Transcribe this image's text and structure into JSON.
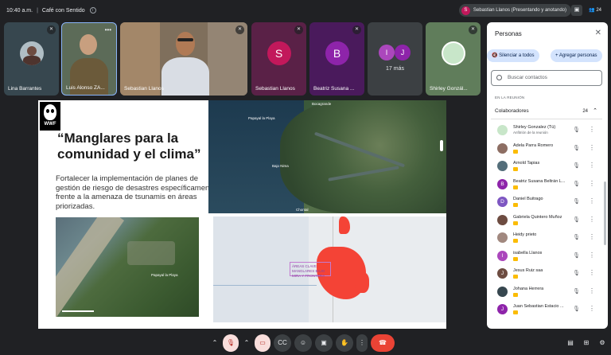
{
  "topbar": {
    "time": "10:40 a.m.",
    "meeting_name": "Café con Sentido",
    "presenter_initial": "S",
    "presenter_label": "Sebastian Llanos (Presentando y anotando)",
    "participant_count": "24"
  },
  "tiles": [
    {
      "name": "Lina Barrantes"
    },
    {
      "name": "Luis Alonso ZA..."
    },
    {
      "name": "Sebastian Llanos"
    },
    {
      "initial": "S",
      "name": "Sebastian Llanos",
      "color": "#c2185b"
    },
    {
      "initial": "B",
      "name": "Beatriz Susana ...",
      "color": "#8e24aa"
    },
    {
      "initials": [
        "I",
        "J"
      ],
      "more": "17 más"
    },
    {
      "name": "Shirley Gonzál..."
    }
  ],
  "slide": {
    "logo_text": "WWF",
    "title": "“Manglares para la comunidad y el clima”",
    "body": "Fortalecer la implementación de planes de gestión de riesgo de desastres específicamente frente a la amenaza de tsunamis en áreas priorizadas.",
    "map_labels": {
      "bocagrande": "Bocagrande",
      "papayal": "Papayal la Playa",
      "chontal": "Chontal",
      "bajonama": "Bajo Nima",
      "papayal_la_playa": "Papayal la Playa",
      "areas_box": "ÁREAS CLAVE MANGLARES BAJO MIRA Y FRONTERA"
    }
  },
  "panel": {
    "title": "Personas",
    "mute_all": "Silenciar a todos",
    "add_people": "Agregar personas",
    "search_placeholder": "Buscar contactos",
    "section": "EN LA REUNIÓN",
    "collaborators": "Colaboradores",
    "collaborators_count": "24",
    "people": [
      {
        "name": "Shirley Gonzalez (Tú)",
        "sub": "Anfitrión de la reunión",
        "color": "#c8e6c9"
      },
      {
        "name": "Adela Parra Romero",
        "color": "#8d6e63"
      },
      {
        "name": "Arnold Tapias",
        "color": "#546e7a"
      },
      {
        "name": "Beatriz Susana Beltrán L...",
        "initial": "B",
        "color": "#8e24aa"
      },
      {
        "name": "Daniel Buitrago",
        "initial": "D",
        "color": "#7e57c2"
      },
      {
        "name": "Gabriela Quintero Muñoz",
        "color": "#6d4c41"
      },
      {
        "name": "Heidy prieto",
        "color": "#a1887f"
      },
      {
        "name": "isabella Llanos",
        "initial": "I",
        "color": "#ab47bc"
      },
      {
        "name": "Jesus Ruiz saa",
        "initial": "J",
        "color": "#6d4c41"
      },
      {
        "name": "Johana Herrera",
        "color": "#37474f"
      },
      {
        "name": "Juan Sebastian Estacio ...",
        "initial": "J",
        "color": "#8e24aa"
      }
    ]
  }
}
